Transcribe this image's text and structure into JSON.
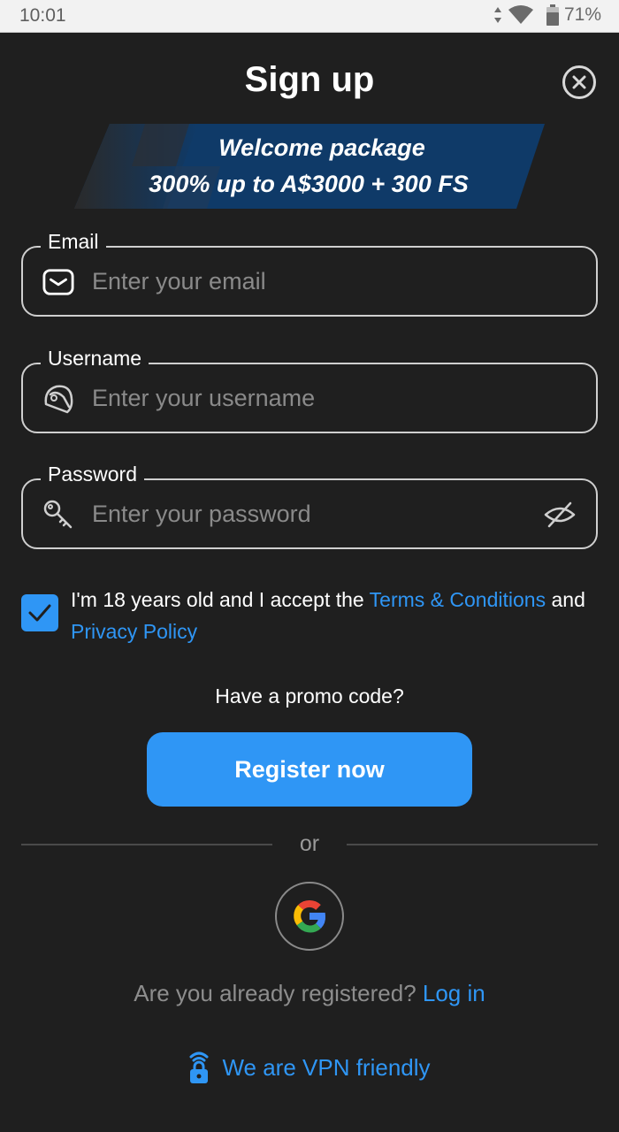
{
  "status_bar": {
    "time": "10:01",
    "battery_percent": "71%",
    "icons": [
      "data-arrows-icon",
      "wifi-icon",
      "battery-icon"
    ]
  },
  "dialog": {
    "title": "Sign up",
    "close_icon": "close-circle-icon"
  },
  "banner": {
    "line1": "Welcome package",
    "line2": "300% up to A$3000 + 300 FS"
  },
  "fields": {
    "email": {
      "label": "Email",
      "placeholder": "Enter your email",
      "value": "",
      "icon": "envelope-icon"
    },
    "username": {
      "label": "Username",
      "placeholder": "Enter your username",
      "value": "",
      "icon": "helmet-icon"
    },
    "password": {
      "label": "Password",
      "placeholder": "Enter your password",
      "value": "",
      "icon": "key-icon",
      "toggle_icon": "eye-off-icon"
    }
  },
  "agreement": {
    "checked": true,
    "text_before": "I'm 18 years old and I accept the ",
    "terms_link": "Terms & Conditions",
    "text_middle": " and ",
    "privacy_link": "Privacy Policy"
  },
  "promo": {
    "label": "Have a promo code?"
  },
  "register_button": {
    "label": "Register now"
  },
  "separator": {
    "label": "or"
  },
  "social": {
    "google_icon": "google-icon"
  },
  "login": {
    "question": "Are you already registered?",
    "link": "Log in"
  },
  "vpn": {
    "label": "We are VPN friendly",
    "icon": "vpn-lock-icon"
  },
  "colors": {
    "background": "#1f1f1f",
    "accent": "#2f96f5",
    "banner_blue": "#0f3a68",
    "placeholder": "#8a8a8a"
  }
}
